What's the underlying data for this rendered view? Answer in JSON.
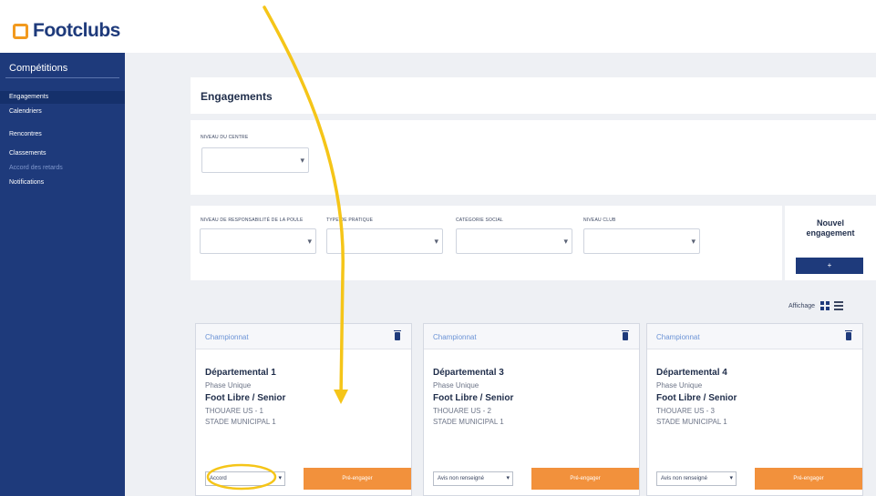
{
  "header": {
    "brand": "Footclubs"
  },
  "sidebar": {
    "title": "Compétitions",
    "items": [
      {
        "label": "Engagements",
        "state": "active"
      },
      {
        "label": "Calendriers",
        "state": "normal"
      },
      {
        "label": "Rencontres",
        "state": "normal"
      },
      {
        "label": "Classements",
        "state": "normal"
      },
      {
        "label": "Accord des retards",
        "state": "muted"
      },
      {
        "label": "Notifications",
        "state": "normal"
      }
    ]
  },
  "main": {
    "title": "Engagements",
    "centre_filter": {
      "label": "NIVEAU DU CENTRE",
      "value": ""
    },
    "filters": [
      {
        "label": "NIVEAU DE RESPONSABILITÉ DE LA POULE",
        "value": ""
      },
      {
        "label": "TYPE DE PRATIQUE",
        "value": ""
      },
      {
        "label": "CATÉGORIE SOCIAL",
        "value": ""
      },
      {
        "label": "NIVEAU CLUB",
        "value": ""
      }
    ],
    "new_engagement": {
      "title_line1": "Nouvel",
      "title_line2": "engagement",
      "button": "+"
    },
    "display_label": "Affichage",
    "cards": [
      {
        "type": "Championnat",
        "level": "Départemental 1",
        "phase": "Phase Unique",
        "category": "Foot Libre / Senior",
        "team": "THOUARE US - 1",
        "stadium": "STADE MUNICIPAL 1",
        "select_value": "Accord",
        "action": "Pré-engager"
      },
      {
        "type": "Championnat",
        "level": "Départemental 3",
        "phase": "Phase Unique",
        "category": "Foot Libre / Senior",
        "team": "THOUARE US - 2",
        "stadium": "STADE MUNICIPAL 1",
        "select_value": "Avis non renseigné",
        "action": "Pré-engager"
      },
      {
        "type": "Championnat",
        "level": "Départemental 4",
        "phase": "Phase Unique",
        "category": "Foot Libre / Senior",
        "team": "THOUARE US - 3",
        "stadium": "STADE MUNICIPAL 1",
        "select_value": "Avis non renseigné",
        "action": "Pré-engager"
      }
    ]
  },
  "colors": {
    "sidebar": "#1e3a7b",
    "accent_orange": "#f2913c",
    "annotation_yellow": "#f5c518",
    "logo_orange": "#f29a1f"
  }
}
